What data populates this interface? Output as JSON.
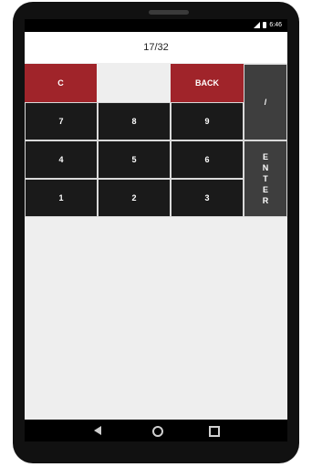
{
  "status_bar": {
    "time": "6:46"
  },
  "display": {
    "value": "17/32"
  },
  "keypad": {
    "clear_label": "C",
    "back_label": "BACK",
    "divide_label": "/",
    "enter_letters": [
      "E",
      "N",
      "T",
      "E",
      "R"
    ],
    "digits": {
      "seven": "7",
      "eight": "8",
      "nine": "9",
      "four": "4",
      "five": "5",
      "six": "6",
      "one": "1",
      "two": "2",
      "three": "3"
    }
  },
  "colors": {
    "red_key": "#a0242a",
    "number_key": "#1a1a1a",
    "side_key": "#3e3e3e"
  },
  "nav_icons": [
    "back-icon",
    "home-icon",
    "recents-icon"
  ]
}
